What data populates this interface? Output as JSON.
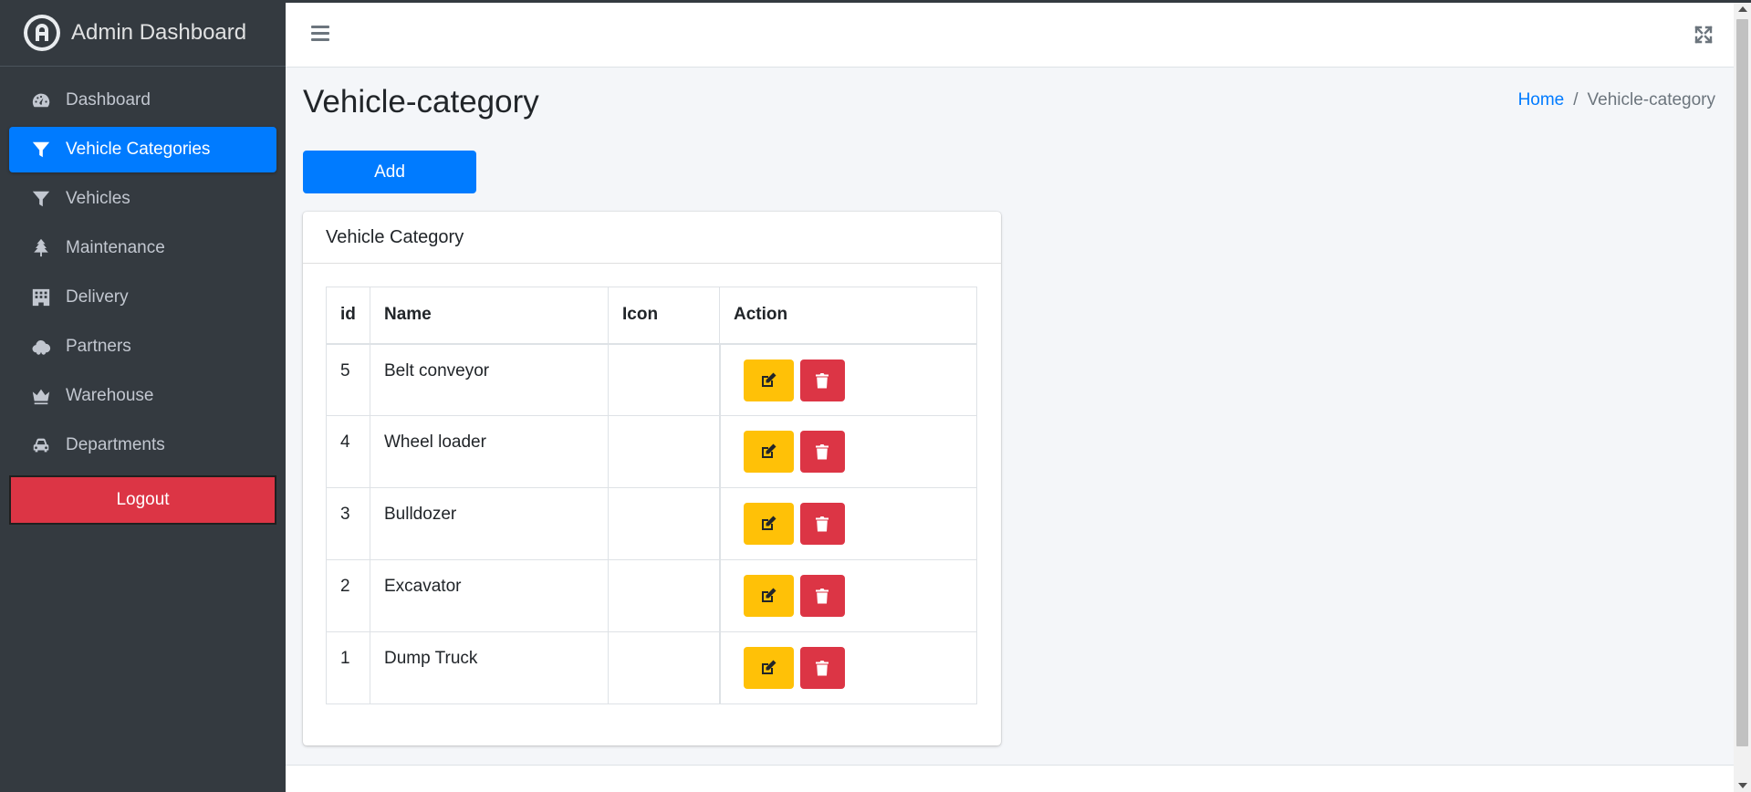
{
  "brand": {
    "title": "Admin Dashboard",
    "logo_letter": "A"
  },
  "sidebar": {
    "items": [
      {
        "label": "Dashboard",
        "icon": "tachometer-icon",
        "active": false
      },
      {
        "label": "Vehicle Categories",
        "icon": "filter-icon",
        "active": true
      },
      {
        "label": "Vehicles",
        "icon": "filter-icon",
        "active": false
      },
      {
        "label": "Maintenance",
        "icon": "tree-icon",
        "active": false
      },
      {
        "label": "Delivery",
        "icon": "building-icon",
        "active": false
      },
      {
        "label": "Partners",
        "icon": "cloud-icon",
        "active": false
      },
      {
        "label": "Warehouse",
        "icon": "crown-icon",
        "active": false
      },
      {
        "label": "Departments",
        "icon": "car-icon",
        "active": false
      }
    ],
    "logout_label": "Logout"
  },
  "header": {
    "menu_icon": "bars-icon",
    "fullscreen_icon": "expand-icon"
  },
  "page": {
    "title": "Vehicle-category",
    "breadcrumb": {
      "home": "Home",
      "separator": "/",
      "current": "Vehicle-category"
    },
    "add_label": "Add"
  },
  "card": {
    "title": "Vehicle Category",
    "columns": [
      "id",
      "Name",
      "Icon",
      "Action"
    ],
    "rows": [
      {
        "id": "5",
        "name": "Belt conveyor",
        "icon": ""
      },
      {
        "id": "4",
        "name": "Wheel loader",
        "icon": ""
      },
      {
        "id": "3",
        "name": "Bulldozer",
        "icon": ""
      },
      {
        "id": "2",
        "name": "Excavator",
        "icon": ""
      },
      {
        "id": "1",
        "name": "Dump Truck",
        "icon": ""
      }
    ]
  },
  "colors": {
    "sidebar_bg": "#343a40",
    "primary": "#007bff",
    "warning": "#ffc107",
    "danger": "#dc3545"
  }
}
